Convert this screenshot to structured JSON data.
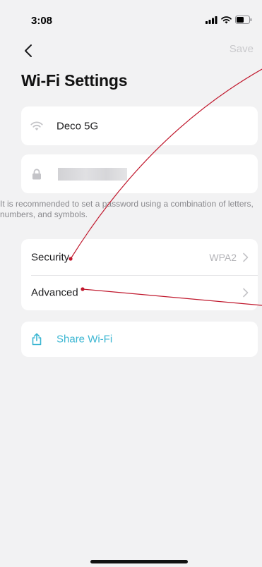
{
  "status_bar": {
    "time": "3:08",
    "icons": [
      "signal-icon",
      "wifi-icon",
      "battery-icon"
    ]
  },
  "nav": {
    "back_icon": "chevron-left-icon",
    "save_label": "Save"
  },
  "page": {
    "title": "Wi-Fi Settings"
  },
  "network": {
    "name_icon": "wifi-icon",
    "name_value": "Deco 5G",
    "password_icon": "lock-icon",
    "password_value_hidden": true,
    "hint": "It is recommended to set a password using a combination of letters, numbers, and symbols."
  },
  "menu": {
    "items": [
      {
        "label": "Security",
        "value": "WPA2",
        "icon": "chevron-right-icon"
      },
      {
        "label": "Advanced",
        "value": "",
        "icon": "chevron-right-icon"
      }
    ]
  },
  "share": {
    "icon": "share-icon",
    "label": "Share Wi-Fi"
  },
  "colors": {
    "background": "#f2f2f3",
    "card": "#ffffff",
    "accent": "#3bb6d2",
    "muted": "#8a8a8e",
    "annotation": "#c0182d"
  }
}
